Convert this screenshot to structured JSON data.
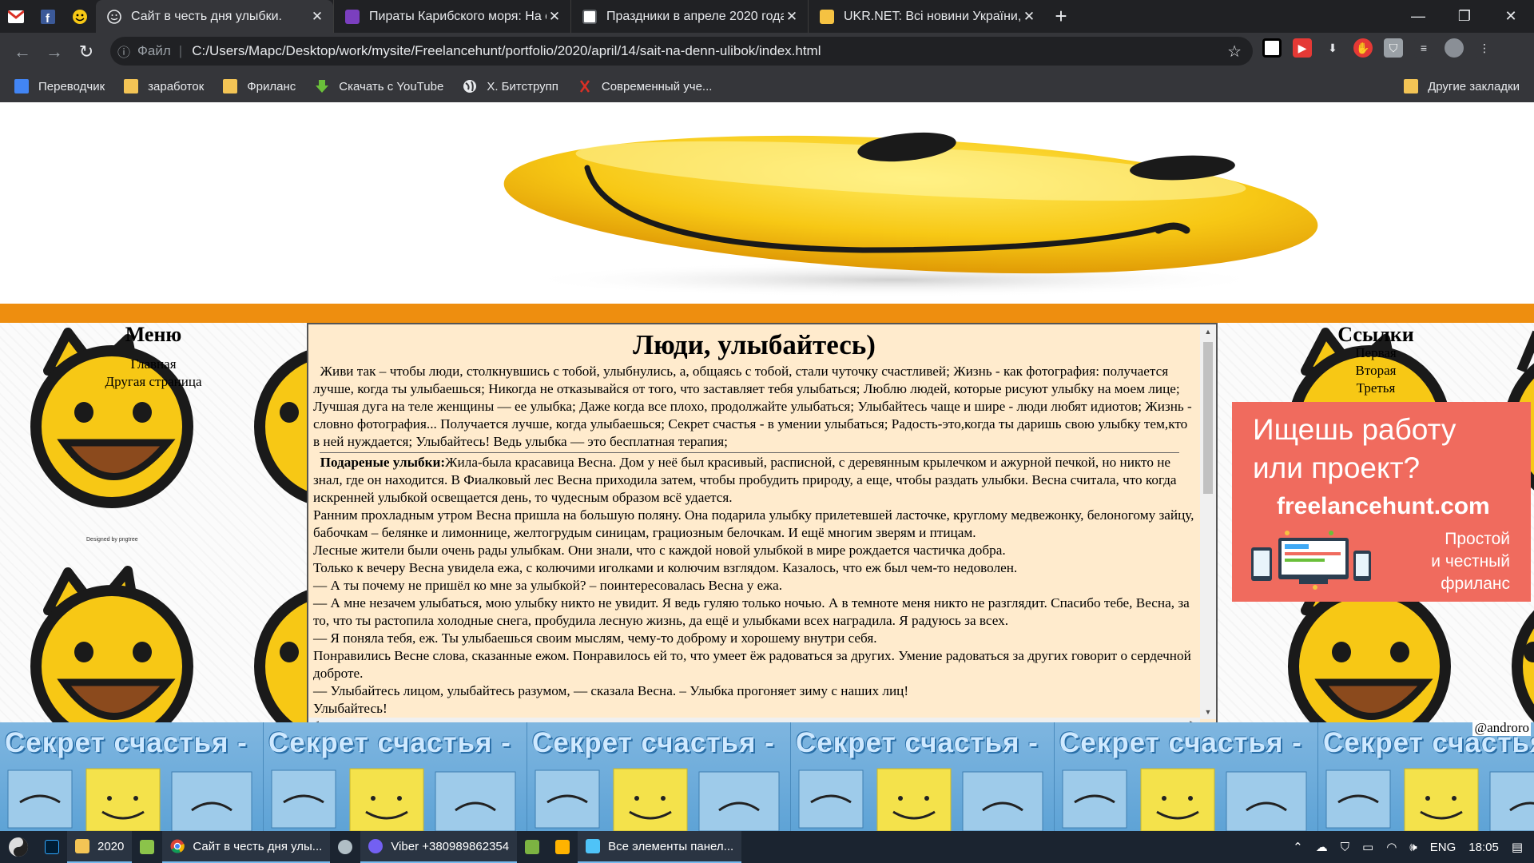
{
  "browser": {
    "tabs": [
      {
        "title": "Сайт в честь дня улыбки.",
        "active": true,
        "favicon_color": "#e8eaed"
      },
      {
        "title": "Пираты Карибского моря: На ст",
        "active": false,
        "favicon_color": "#7b3fbf"
      },
      {
        "title": "Праздники в апреле 2020 года",
        "active": false,
        "favicon_color": "#ffffff"
      },
      {
        "title": "UKR.NET: Всі новини України, ос",
        "active": false,
        "favicon_color": "#f5c242"
      }
    ],
    "address": {
      "scheme_label": "Файл",
      "url": "C:/Users/Марс/Desktop/work/mysite/Freelancehunt/portfolio/2020/april/14/sait-na-denn-ulibok/index.html"
    },
    "bookmarks": [
      {
        "label": "Переводчик",
        "icon": "translate-icon"
      },
      {
        "label": "заработок",
        "icon": "folder-icon"
      },
      {
        "label": "Фриланс",
        "icon": "folder-icon"
      },
      {
        "label": "Скачать с YouTube",
        "icon": "download-icon"
      },
      {
        "label": "Х. Битструпп",
        "icon": "globe-icon"
      },
      {
        "label": "Современный уче...",
        "icon": "ribbon-icon"
      }
    ],
    "other_bookmarks": "Другие закладки"
  },
  "page": {
    "left_sidebar": {
      "title": "Меню",
      "links": [
        "Главная",
        "Другая страница"
      ],
      "designed_by": "Designed by pngtree"
    },
    "right_sidebar": {
      "title": "Ссылки",
      "links": [
        "Первая",
        "Вторая",
        "Третья"
      ]
    },
    "ad": {
      "line1": "Ищешь работу",
      "line2": "или проект?",
      "site": "freelancehunt.com",
      "slogan1": "Простой",
      "slogan2": "и честный",
      "slogan3": "фриланс"
    },
    "main": {
      "heading": "Люди, улыбайтесь)",
      "intro": "Живи так – чтобы люди, столкнувшись с тобой, улыбнулись, а, общаясь с тобой, стали чуточку счастливей; Жизнь - как фотография: получается лучше, когда ты улыбаешься; Никогда не отказывайся от того, что заставляет тебя улыбаться; Люблю людей, которые рисуют улыбку на моем лице; Лучшая дуга на теле женщины — ее улыбка; Даже когда все плохо, продолжайте улыбаться; Улыбайтесь чаще и шире - люди любят идиотов; Жизнь - словно фотография... Получается лучше, когда улыбаешься; Секрет счастья - в умении улыбаться; Радость-это,когда ты даришь свою улыбку тем,кто в ней нуждается; Улыбайтесь! Ведь улыбка — это бесплатная терапия;",
      "story_title": "Подареные улыбки:",
      "story_first": "Жила-была красавица Весна. Дом у неё был красивый, расписной, с деревянным крылечком и ажурной печкой, но никто не знал, где он находится. В Фиалковый лес Весна приходила затем, чтобы пробудить природу, а еще, чтобы раздать улыбки. Весна считала, что когда искренней улыбкой освещается день, то чудесным образом всё удается.",
      "story_paragraphs": [
        "Ранним прохладным утром Весна пришла на большую поляну. Она подарила улыбку прилетевшей ласточке, круглому медвежонку, белоногому зайцу, бабочкам – белянке и лимоннице, желтогрудым синицам, грациозным белочкам. И ещё многим зверям и птицам.",
        "Лесные жители были очень рады улыбкам. Они знали, что с каждой новой улыбкой в мире рождается частичка добра.",
        "Только к вечеру Весна увидела ежа, с колючими иголками и колючим взглядом. Казалось, что еж был чем-то недоволен.",
        "— А ты почему не пришёл ко мне за улыбкой? – поинтересовалась Весна у ежа.",
        "— А мне незачем улыбаться, мою улыбку никто не увидит. Я ведь гуляю только ночью. А в темноте меня никто не разглядит. Спасибо тебе, Весна, за то, что ты растопила холодные снега, пробудила лесную жизнь, да ещё и улыбками всех наградила. Я радуюсь за всех.",
        "— Я поняла тебя, еж. Ты улыбаешься своим мыслям, чему-то доброму и хорошему внутри себя.",
        "Понравились Весне слова, сказанные ежом. Понравилось ей то, что умеет ёж радоваться за других. Умение радоваться за других говорит о сердечной доброте.",
        "— Улыбайтесь лицом, улыбайтесь разумом, — сказала Весна. – Улыбка прогоняет зиму с наших лиц!",
        "Улыбайтесь!"
      ]
    },
    "author": "@androro",
    "footer_banner": "Секрет счастья -",
    "colors": {
      "orange_bar": "#ee8e0f",
      "content_bg": "#ffebcd",
      "smiley": "#f7c815",
      "ad_bg": "#f06b5e"
    }
  },
  "taskbar": {
    "items": [
      {
        "label": "",
        "icon": "yin-yang-icon"
      },
      {
        "label": "",
        "icon": "photoshop-icon"
      },
      {
        "label": "2020",
        "icon": "folder-icon"
      },
      {
        "label": "",
        "icon": "notepad-icon"
      },
      {
        "label": "Сайт в честь дня улы...",
        "icon": "chrome-icon"
      },
      {
        "label": "",
        "icon": "paint-icon"
      },
      {
        "label": "Viber +380989862354",
        "icon": "viber-icon"
      },
      {
        "label": "",
        "icon": "app-icon"
      },
      {
        "label": "",
        "icon": "app-icon"
      },
      {
        "label": "Все элементы панел...",
        "icon": "control-panel-icon"
      }
    ],
    "lang": "ENG",
    "time": "18:05"
  }
}
